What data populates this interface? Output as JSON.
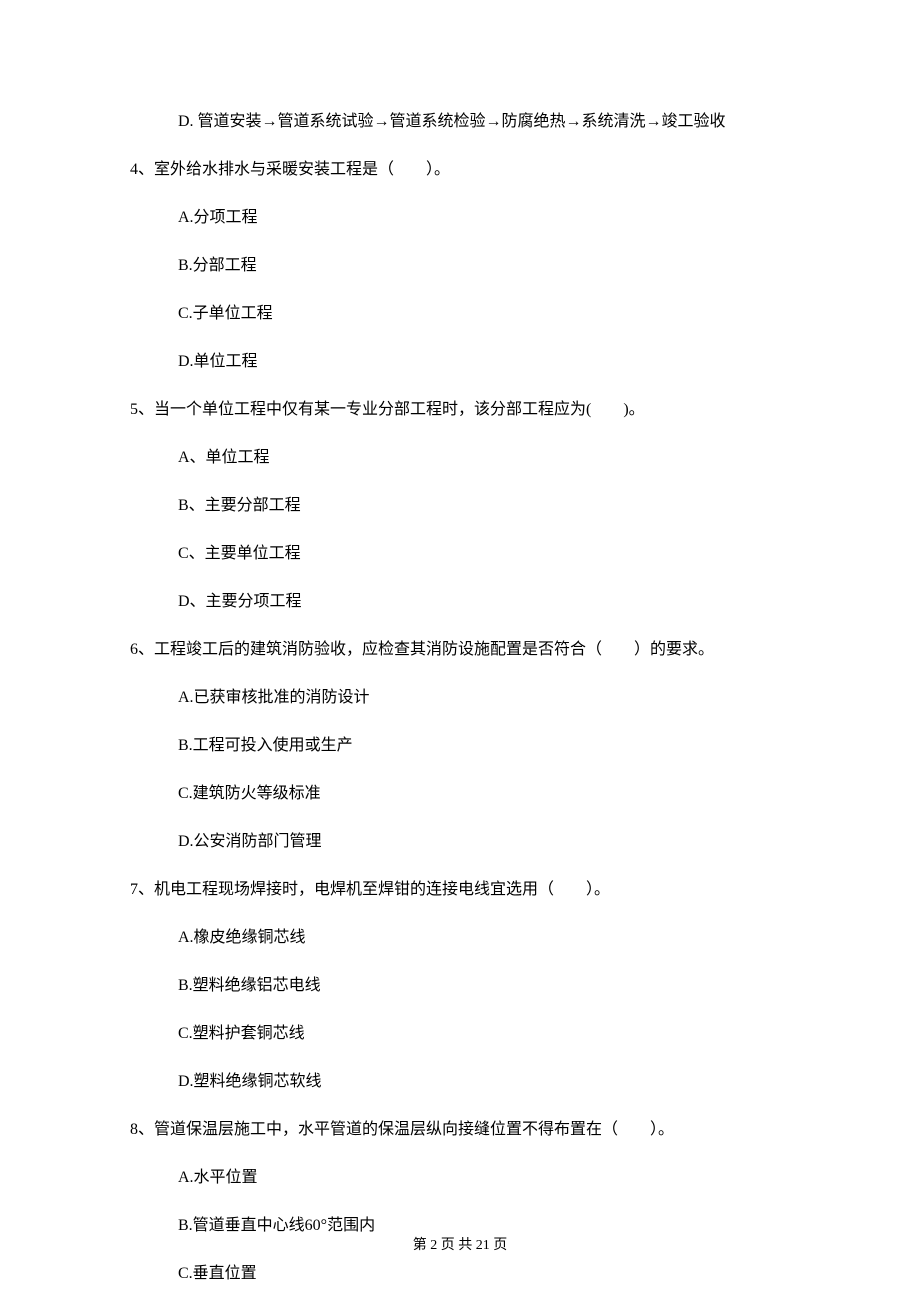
{
  "lines": {
    "q3_d": "D. 管道安装→管道系统试验→管道系统检验→防腐绝热→系统清洗→竣工验收",
    "q4_text": "4、室外给水排水与采暖安装工程是（　　）。",
    "q4_a": "A.分项工程",
    "q4_b": "B.分部工程",
    "q4_c": "C.子单位工程",
    "q4_d": "D.单位工程",
    "q5_text": "5、当一个单位工程中仅有某一专业分部工程时，该分部工程应为(　　)。",
    "q5_a": "A、单位工程",
    "q5_b": "B、主要分部工程",
    "q5_c": "C、主要单位工程",
    "q5_d": "D、主要分项工程",
    "q6_text": "6、工程竣工后的建筑消防验收，应检查其消防设施配置是否符合（　　）的要求。",
    "q6_a": "A.已获审核批准的消防设计",
    "q6_b": "B.工程可投入使用或生产",
    "q6_c": "C.建筑防火等级标准",
    "q6_d": "D.公安消防部门管理",
    "q7_text": "7、机电工程现场焊接时，电焊机至焊钳的连接电线宜选用（　　）。",
    "q7_a": "A.橡皮绝缘铜芯线",
    "q7_b": "B.塑料绝缘铝芯电线",
    "q7_c": "C.塑料护套铜芯线",
    "q7_d": "D.塑料绝缘铜芯软线",
    "q8_text": "8、管道保温层施工中，水平管道的保温层纵向接缝位置不得布置在（　　）。",
    "q8_a": "A.水平位置",
    "q8_b": "B.管道垂直中心线60°范围内",
    "q8_c": "C.垂直位置"
  },
  "footer": "第 2 页 共 21 页"
}
